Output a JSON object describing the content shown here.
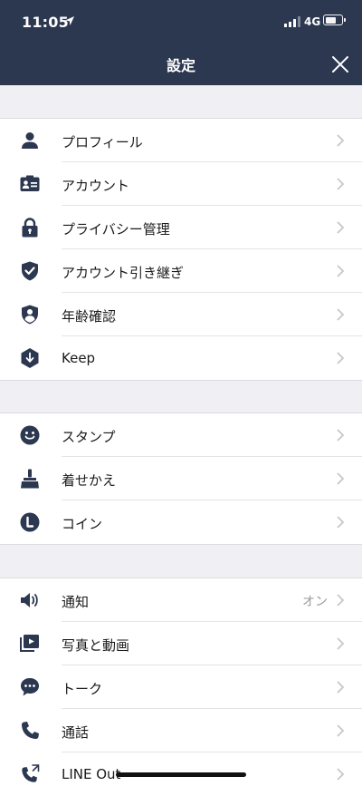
{
  "status": {
    "time": "11:05",
    "network": "4G"
  },
  "header": {
    "title": "設定"
  },
  "sections": [
    {
      "items": [
        {
          "label": "プロフィール"
        },
        {
          "label": "アカウント"
        },
        {
          "label": "プライバシー管理"
        },
        {
          "label": "アカウント引き継ぎ"
        },
        {
          "label": "年齢確認"
        },
        {
          "label": "Keep"
        }
      ]
    },
    {
      "items": [
        {
          "label": "スタンプ"
        },
        {
          "label": "着せかえ"
        },
        {
          "label": "コイン"
        }
      ]
    },
    {
      "items": [
        {
          "label": "通知",
          "value": "オン"
        },
        {
          "label": "写真と動画"
        },
        {
          "label": "トーク"
        },
        {
          "label": "通話"
        },
        {
          "label": "LINE Out"
        }
      ]
    }
  ],
  "colors": {
    "header_bg": "#2c3750",
    "icon": "#2c3750",
    "chevron": "#c7c7cc",
    "background": "#efeff4"
  }
}
